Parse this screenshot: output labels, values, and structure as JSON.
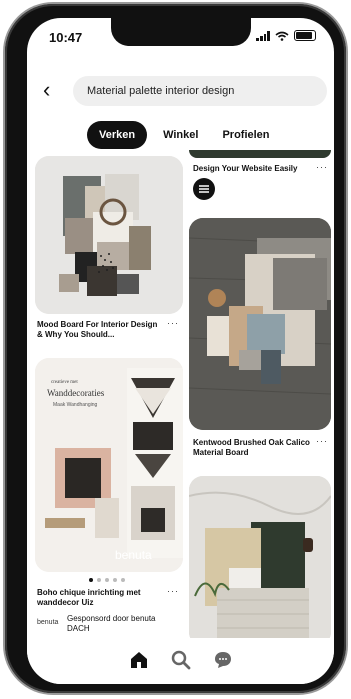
{
  "status": {
    "time": "10:47"
  },
  "search": {
    "query": "Material palette interior design"
  },
  "tabs": [
    {
      "label": "Verken"
    },
    {
      "label": "Winkel"
    },
    {
      "label": "Profielen"
    }
  ],
  "pins": {
    "top_right_title": "Design Your Website Easily",
    "mood_board_title": "Mood Board For Interior Design & Why You Should...",
    "kentwood_title": "Kentwood Brushed Oak Calico Material Board",
    "boho_title": "Boho chique inrichting met wanddecor Uiz",
    "boho_overlay_brand_small": "creatieve met",
    "boho_overlay_heading": "Wanddecoraties",
    "boho_overlay_sub": "Maak Wandhanging",
    "boho_overlay_brand": "benuta",
    "sponsor_logo": "benuta",
    "sponsor_line": "Gesponsord door benuta DACH"
  },
  "more_label": "···"
}
